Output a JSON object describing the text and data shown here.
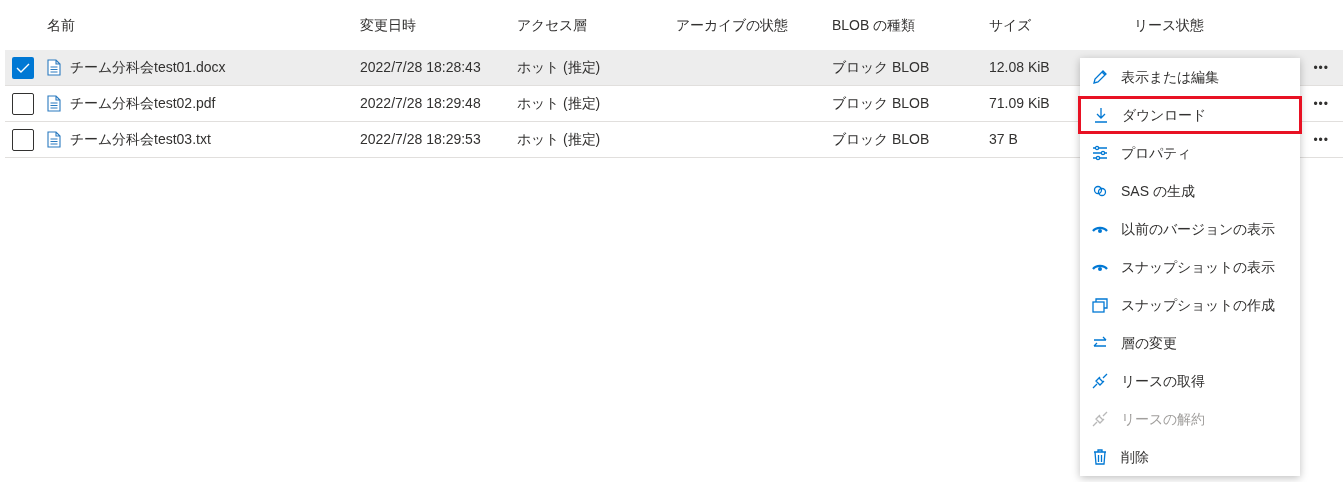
{
  "table": {
    "columns": [
      "名前",
      "変更日時",
      "アクセス層",
      "アーカイブの状態",
      "BLOB の種類",
      "サイズ",
      "リース状態"
    ],
    "rows": [
      {
        "selected": true,
        "name": "チーム分科会test01.docx",
        "modified": "2022/7/28 18:28:43",
        "access_tier": "ホット (推定)",
        "blob_type": "ブロック BLOB",
        "size": "12.08 KiB",
        "more": "•••"
      },
      {
        "selected": false,
        "name": "チーム分科会test02.pdf",
        "modified": "2022/7/28 18:29:48",
        "access_tier": "ホット (推定)",
        "blob_type": "ブロック BLOB",
        "size": "71.09 KiB",
        "more": "•••"
      },
      {
        "selected": false,
        "name": "チーム分科会test03.txt",
        "modified": "2022/7/28 18:29:53",
        "access_tier": "ホット (推定)",
        "blob_type": "ブロック BLOB",
        "size": "37 B",
        "more": "•••"
      }
    ]
  },
  "context_menu": {
    "items": [
      {
        "kind": "edit",
        "label": "表示または編集",
        "disabled": false,
        "highlighted": false
      },
      {
        "kind": "download",
        "label": "ダウンロード",
        "disabled": false,
        "highlighted": true
      },
      {
        "kind": "properties",
        "label": "プロパティ",
        "disabled": false,
        "highlighted": false
      },
      {
        "kind": "link",
        "label": "SAS の生成",
        "disabled": false,
        "highlighted": false
      },
      {
        "kind": "view",
        "label": "以前のバージョンの表示",
        "disabled": false,
        "highlighted": false
      },
      {
        "kind": "view",
        "label": "スナップショットの表示",
        "disabled": false,
        "highlighted": false
      },
      {
        "kind": "snapshot",
        "label": "スナップショットの作成",
        "disabled": false,
        "highlighted": false
      },
      {
        "kind": "swap",
        "label": "層の変更",
        "disabled": false,
        "highlighted": false
      },
      {
        "kind": "plug",
        "label": "リースの取得",
        "disabled": false,
        "highlighted": false
      },
      {
        "kind": "plug",
        "label": "リースの解約",
        "disabled": true,
        "highlighted": false
      },
      {
        "kind": "delete",
        "label": "削除",
        "disabled": false,
        "highlighted": false
      }
    ]
  }
}
